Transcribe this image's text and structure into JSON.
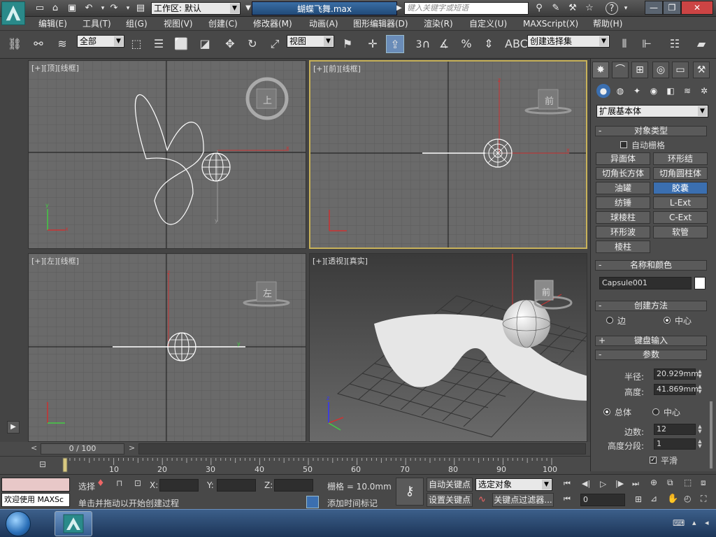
{
  "titlebar": {
    "workspace_label": "工作区: 默认",
    "document_title": "蝴蝶飞舞.max",
    "search_placeholder": "键入关键字或短语",
    "colors": {
      "title_active": "#2f5f92",
      "logo": "#2a8a8a"
    }
  },
  "menu": {
    "items": [
      "编辑(E)",
      "工具(T)",
      "组(G)",
      "视图(V)",
      "创建(C)",
      "修改器(M)",
      "动画(A)",
      "图形编辑器(D)",
      "渲染(R)",
      "自定义(U)",
      "MAXScript(X)",
      "帮助(H)"
    ]
  },
  "toolbar": {
    "selection_filter": "全部",
    "reference_coord": "视图",
    "snap_angle_label": "3",
    "named_selection_placeholder": "创建选择集",
    "icons": [
      "link-icon",
      "unlink-icon",
      "bind-spacewarp-icon",
      "select-object-icon",
      "select-by-name-icon",
      "rect-selection-icon",
      "window-crossing-icon",
      "move-icon",
      "rotate-icon",
      "scale-icon",
      "pivot-icon",
      "manipulate-icon",
      "snap-icon",
      "angle-snap-icon",
      "percent-snap-icon",
      "spinner-snap-icon",
      "edit-named-sel-icon",
      "mirror-icon",
      "align-icon",
      "layer-icon",
      "render-setup-icon"
    ]
  },
  "viewports": {
    "top": {
      "label": "[+][顶][线框]",
      "cube_label": "上"
    },
    "front": {
      "label": "[+][前][线框]",
      "cube_label": "前"
    },
    "left": {
      "label": "[+][左][线框]",
      "cube_label": "左"
    },
    "perspective": {
      "label": "[+][透视][真实]",
      "cube_label": "前"
    },
    "axis_labels": {
      "x": "x",
      "y": "y",
      "z": "z"
    }
  },
  "command_panel": {
    "category_dropdown": "扩展基本体",
    "object_type": {
      "title": "对象类型",
      "autogrid_label": "自动栅格",
      "buttons": [
        "异面体",
        "环形结",
        "切角长方体",
        "切角圆柱体",
        "油罐",
        "胶囊",
        "纺锤",
        "L-Ext",
        "球棱柱",
        "C-Ext",
        "环形波",
        "软管",
        "棱柱"
      ],
      "selected": "胶囊"
    },
    "name_color": {
      "title": "名称和颜色",
      "name_value": "Capsule001",
      "swatch_color": "#ffffff"
    },
    "creation_method": {
      "title": "创建方法",
      "option_edge": "边",
      "option_center": "中心",
      "selected": "中心"
    },
    "keyboard_entry": {
      "title": "键盘输入"
    },
    "parameters": {
      "title": "参数",
      "radius_label": "半径:",
      "radius_value": "20.929mm",
      "height_label": "高度:",
      "height_value": "41.869mm",
      "option_overall": "总体",
      "option_center": "中心",
      "selected_height_mode": "总体",
      "sides_label": "边数:",
      "sides_value": "12",
      "height_segs_label": "高度分段:",
      "height_segs_value": "1",
      "smooth_label": "平滑",
      "smooth_checked": true
    }
  },
  "timeline": {
    "frame_readout": "0 / 100",
    "ticks": [
      "10",
      "20",
      "30",
      "40",
      "50",
      "60",
      "70",
      "80",
      "90",
      "100"
    ]
  },
  "status": {
    "listener_text": "欢迎使用 MAXSc",
    "selection_label": "选择",
    "x_label": "X:",
    "y_label": "Y:",
    "z_label": "Z:",
    "grid_label": "栅格 = 10.0mm",
    "prompt_text": "单击并拖动以开始创建过程",
    "add_time_tag": "添加时间标记",
    "auto_key": "自动关键点",
    "set_key": "设置关键点",
    "key_mode_select": "选定对象",
    "key_filters": "关键点过滤器...",
    "frame_field": "0"
  }
}
